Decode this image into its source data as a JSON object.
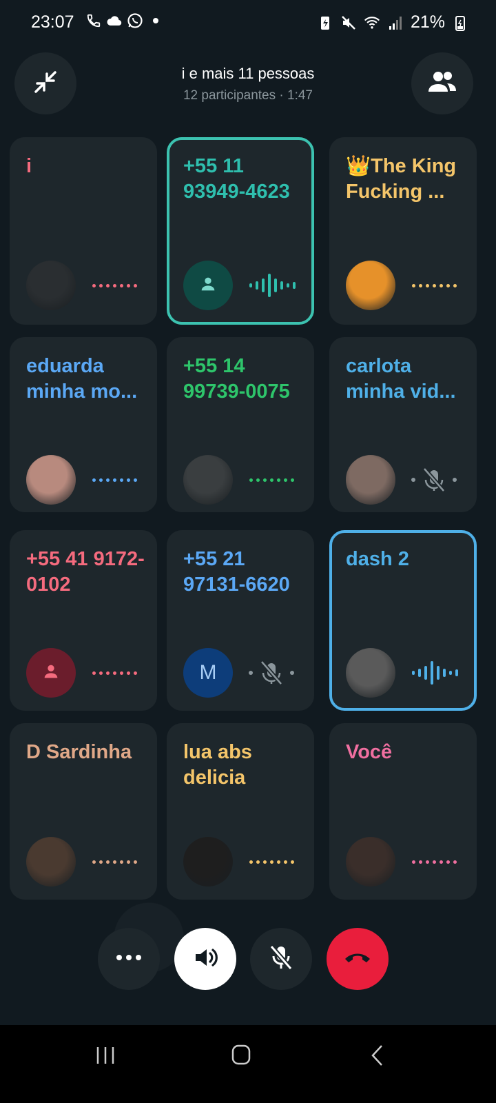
{
  "status_bar": {
    "time": "23:07",
    "battery": "21%",
    "left_icons": [
      "phone-icon",
      "cloud-icon",
      "whatsapp-icon",
      "dot-icon"
    ],
    "right_icons": [
      "battery-saver-icon",
      "mute-icon",
      "wifi-icon",
      "signal-icon",
      "battery-icon"
    ]
  },
  "header": {
    "title": "i e mais 11 pessoas",
    "subtitle": "12 participantes · 1:47",
    "minimize_icon": "minimize-icon",
    "participants_icon": "people-icon"
  },
  "participants": [
    {
      "name": "i",
      "color": "#f56b7e",
      "avatar": "photo",
      "avatar_color": "#2a2e31",
      "status": "dots",
      "active": false
    },
    {
      "name": "+55 11 93949-4623",
      "color": "#2fbfae",
      "avatar": "person",
      "avatar_color": "#0f4a44",
      "icon_color": "#7ed9cc",
      "status": "speaking",
      "active": true,
      "border": "#3cc2b0"
    },
    {
      "name": "👑The King Fucking ...",
      "color": "#f4c56a",
      "avatar": "photo",
      "avatar_color": "#e6912a",
      "status": "dots",
      "active": false
    },
    {
      "name": "eduarda minha mo...",
      "color": "#5ba8f5",
      "avatar": "photo",
      "avatar_color": "#b88a7e",
      "status": "dots",
      "active": false
    },
    {
      "name": "+55 14 99739-0075",
      "color": "#2ec56b",
      "avatar": "photo",
      "avatar_color": "#3a3e40",
      "status": "dots",
      "active": false
    },
    {
      "name": "carlota minha vid...",
      "color": "#4fb0e8",
      "avatar": "photo",
      "avatar_color": "#7e6a62",
      "status": "muted",
      "active": false
    },
    {
      "name": "+55 41 9172-0102",
      "color": "#f56b7e",
      "avatar": "person",
      "avatar_color": "#6b1d2c",
      "icon_color": "#f56b7e",
      "status": "dots",
      "active": false
    },
    {
      "name": "+55 21 97131-6620",
      "color": "#5ba8f5",
      "avatar": "letter",
      "letter": "M",
      "avatar_color": "#0d3d7a",
      "icon_color": "#a7cdf5",
      "status": "muted",
      "active": false
    },
    {
      "name": "dash 2",
      "color": "#4fb0e8",
      "avatar": "photo",
      "avatar_color": "#5a5a5a",
      "status": "speaking",
      "active": true,
      "border": "#4fb0e8"
    },
    {
      "name": "D Sardinha",
      "color": "#e0a888",
      "avatar": "photo",
      "avatar_color": "#4a3a30",
      "status": "dots",
      "active": false
    },
    {
      "name": "lua abs delicia",
      "color": "#f4c56a",
      "avatar": "photo",
      "avatar_color": "#1e1e1e",
      "status": "dots",
      "active": false
    },
    {
      "name": "Você",
      "color": "#f06fa0",
      "avatar": "photo",
      "avatar_color": "#3a2e2a",
      "status": "dots",
      "active": false
    }
  ],
  "controls": [
    {
      "name": "more-button",
      "icon": "more-icon",
      "bg": "#1e272c",
      "fg": "#ffffff"
    },
    {
      "name": "speaker-button",
      "icon": "speaker-icon",
      "bg": "#ffffff",
      "fg": "#111a20"
    },
    {
      "name": "mute-mic-button",
      "icon": "mic-off-icon",
      "bg": "#1e272c",
      "fg": "#ffffff"
    },
    {
      "name": "end-call-button",
      "icon": "end-call-icon",
      "bg": "#e91e3c",
      "fg": "#111a20"
    }
  ],
  "navbar": {
    "icons": [
      "recent-apps-icon",
      "home-icon",
      "back-icon"
    ]
  }
}
